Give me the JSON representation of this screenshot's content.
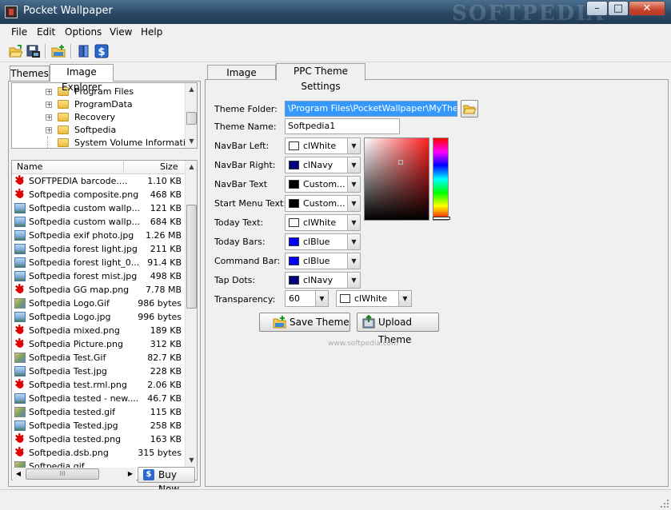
{
  "window": {
    "title": "Pocket Wallpaper",
    "watermark": "SOFTPEDIA"
  },
  "menu": [
    "File",
    "Edit",
    "Options",
    "View",
    "Help"
  ],
  "left_tabs": [
    "Themes",
    "Image Explorer"
  ],
  "folder_tree": [
    "Program Files",
    "ProgramData",
    "Recovery",
    "Softpedia",
    "System Volume Information"
  ],
  "file_list": {
    "headers": {
      "name": "Name",
      "size": "Size"
    },
    "rows": [
      {
        "name": "SOFTPEDIA barcode....",
        "size": "1.10 KB",
        "icon": "star"
      },
      {
        "name": "Softpedia composite.png",
        "size": "468 KB",
        "icon": "star"
      },
      {
        "name": "Softpedia custom wallp...",
        "size": "121 KB",
        "icon": "img"
      },
      {
        "name": "Softpedia custom wallp...",
        "size": "684 KB",
        "icon": "img"
      },
      {
        "name": "Softpedia exif photo.jpg",
        "size": "1.26 MB",
        "icon": "img"
      },
      {
        "name": "Softpedia forest light.jpg",
        "size": "211 KB",
        "icon": "img"
      },
      {
        "name": "Softpedia forest light_0...",
        "size": "91.4 KB",
        "icon": "img"
      },
      {
        "name": "Softpedia forest mist.jpg",
        "size": "498 KB",
        "icon": "img"
      },
      {
        "name": "Softpedia GG map.png",
        "size": "7.78 MB",
        "icon": "star"
      },
      {
        "name": "Softpedia Logo.Gif",
        "size": "986 bytes",
        "icon": "pic"
      },
      {
        "name": "Softpedia Logo.jpg",
        "size": "996 bytes",
        "icon": "img"
      },
      {
        "name": "Softpedia mixed.png",
        "size": "189 KB",
        "icon": "star"
      },
      {
        "name": "Softpedia Picture.png",
        "size": "312 KB",
        "icon": "star"
      },
      {
        "name": "Softpedia Test.Gif",
        "size": "82.7 KB",
        "icon": "pic"
      },
      {
        "name": "Softpedia Test.jpg",
        "size": "228 KB",
        "icon": "img"
      },
      {
        "name": "Softpedia test.rml.png",
        "size": "2.06 KB",
        "icon": "star"
      },
      {
        "name": "Softpedia tested - new....",
        "size": "46.7 KB",
        "icon": "img"
      },
      {
        "name": "Softpedia tested.gif",
        "size": "115 KB",
        "icon": "pic"
      },
      {
        "name": "Softpedia Tested.jpg",
        "size": "258 KB",
        "icon": "img"
      },
      {
        "name": "Softpedia tested.png",
        "size": "163 KB",
        "icon": "star"
      },
      {
        "name": "Softpedia.dsb.png",
        "size": "315 bytes",
        "icon": "star"
      },
      {
        "name": "Softpedia.gif",
        "size": "",
        "icon": "pic"
      }
    ]
  },
  "buy_now": "Buy Now",
  "right_tabs": [
    "Image Selection",
    "PPC Theme Settings"
  ],
  "settings": {
    "theme_folder_label": "Theme Folder:",
    "theme_folder_value": "\\Program Files\\PocketWallpaper\\MyThemes",
    "theme_name_label": "Theme Name:",
    "theme_name_value": "Softpedia1",
    "rows": [
      {
        "label": "NavBar Left:",
        "value": "clWhite",
        "color": "#ffffff"
      },
      {
        "label": "NavBar Right:",
        "value": "clNavy",
        "color": "#000080"
      },
      {
        "label": "NavBar Text",
        "value": "Custom...",
        "color": "#000000"
      },
      {
        "label": "Start Menu Text:",
        "value": "Custom...",
        "color": "#000000"
      },
      {
        "label": "Today Text:",
        "value": "clWhite",
        "color": "#ffffff"
      },
      {
        "label": "Today Bars:",
        "value": "clBlue",
        "color": "#0000ff"
      },
      {
        "label": "Command Bar:",
        "value": "clBlue",
        "color": "#0000ff"
      },
      {
        "label": "Tap Dots:",
        "value": "clNavy",
        "color": "#000080"
      }
    ],
    "transparency_label": "Transparency:",
    "transparency_value": "60",
    "transparency_color": "clWhite",
    "transparency_swatch": "#ffffff",
    "save_theme": "Save Theme",
    "upload_theme": "Upload Theme",
    "watermark_url": "www.softpedia.com"
  },
  "accent_color": "#3399ff"
}
